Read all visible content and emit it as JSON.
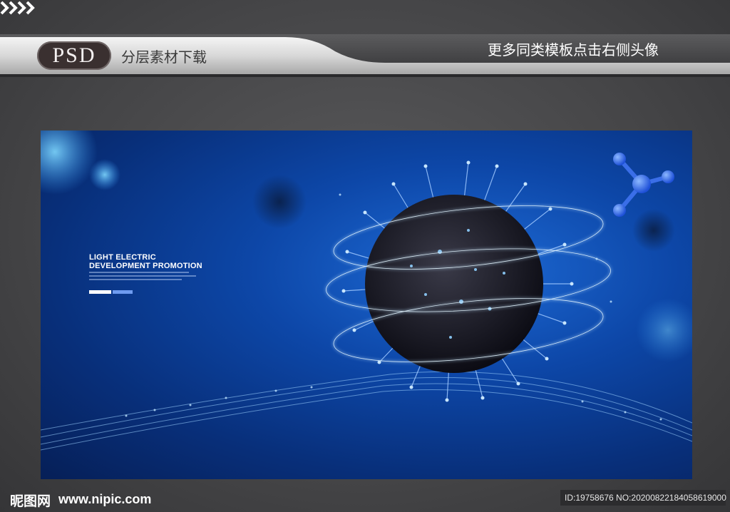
{
  "header": {
    "badge": "PSD",
    "left_text": "分层素材下载",
    "right_text": "更多同类模板点击右侧头像"
  },
  "artwork": {
    "title_line1": "LIGHT ELECTRIC",
    "title_line2": "DEVELOPMENT PROMOTION",
    "colors": {
      "deep_blue": "#061f57",
      "bright_blue": "#1e6bd6",
      "glow": "#9fd4ff"
    }
  },
  "footer": {
    "logo": "昵图网",
    "url": "www.nipic.com",
    "id_text": "ID:19758676 NO:20200822184058619000"
  },
  "icons": [
    "chevrons-right-icon",
    "virus-illustration",
    "molecule-icon"
  ]
}
